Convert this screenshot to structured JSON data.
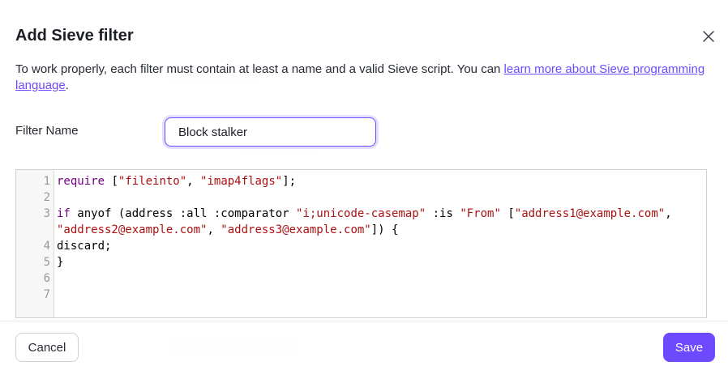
{
  "modal": {
    "title": "Add Sieve filter",
    "intro_text": "To work properly, each filter must contain at least a name and a valid Sieve script. You can ",
    "intro_link": "learn more about Sieve programming language",
    "intro_end": ".",
    "close_icon": "close-icon"
  },
  "form": {
    "filter_name_label": "Filter Name",
    "filter_name_value": "Block stalker"
  },
  "editor": {
    "line_numbers": [
      "1",
      "2",
      "3",
      "4",
      "5",
      "6",
      "7"
    ],
    "lines": {
      "l1_kw": "require",
      "l1_a": " [",
      "l1_s1": "\"fileinto\"",
      "l1_b": ", ",
      "l1_s2": "\"imap4flags\"",
      "l1_c": "];",
      "l3_kw": "if",
      "l3_a": " anyof (address :all :comparator ",
      "l3_s1": "\"i;unicode-casemap\"",
      "l3_b": " :is ",
      "l3_s2": "\"From\"",
      "l3_c": " [",
      "l3_s3": "\"address1@example.com\"",
      "l3_d": ",",
      "l3w_s1": "\"address2@example.com\"",
      "l3w_a": ", ",
      "l3w_s2": "\"address3@example.com\"",
      "l3w_b": "]) {",
      "l4": "discard;",
      "l5": "}"
    }
  },
  "footer": {
    "cancel_label": "Cancel",
    "save_label": "Save"
  },
  "colors": {
    "accent": "#6d4aff",
    "keyword": "#770088",
    "string": "#aa1111"
  }
}
